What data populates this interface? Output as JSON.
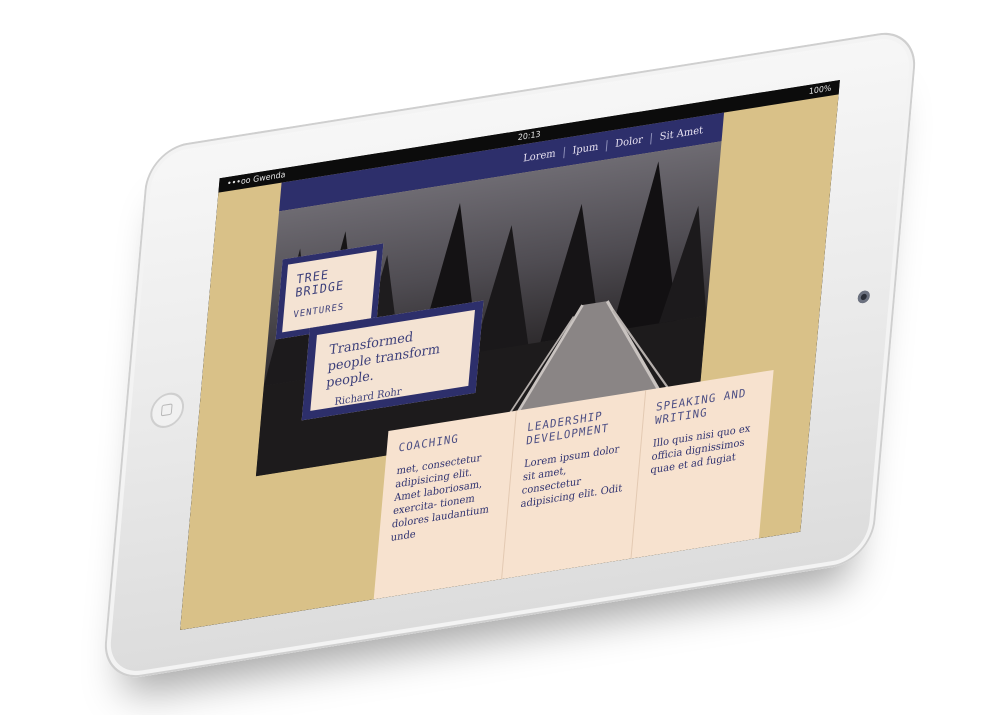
{
  "status_bar": {
    "carrier": "•••oo Gwenda",
    "time": "20:13",
    "battery": "100%"
  },
  "nav": {
    "items": [
      "Lorem",
      "Ipum",
      "Dolor",
      "Sit Amet"
    ]
  },
  "logo": {
    "line1": "TREE",
    "line2": "BRIDGE",
    "subtitle": "VENTURES"
  },
  "quote": {
    "text": "Transformed people transform people.",
    "author": "Richard Rohr"
  },
  "cards": [
    {
      "title": "COACHING",
      "body": "met, consectetur adipisicing elit. Amet laboriosam, exercita- tionem dolores laudantium unde"
    },
    {
      "title": "LEADERSHIP DEVELOPMENT",
      "body": "Lorem ipsum dolor sit amet, consectetur adipisicing elit. Odit"
    },
    {
      "title": "SPEAKING AND WRITING",
      "body": "Illo quis nisi quo ex officia dignissimos quae et ad fugiat"
    }
  ],
  "colors": {
    "navy": "#2d2f6b",
    "sand": "#d9c188",
    "cream": "#f4e3d3",
    "text_blue": "#3c3f7a"
  }
}
